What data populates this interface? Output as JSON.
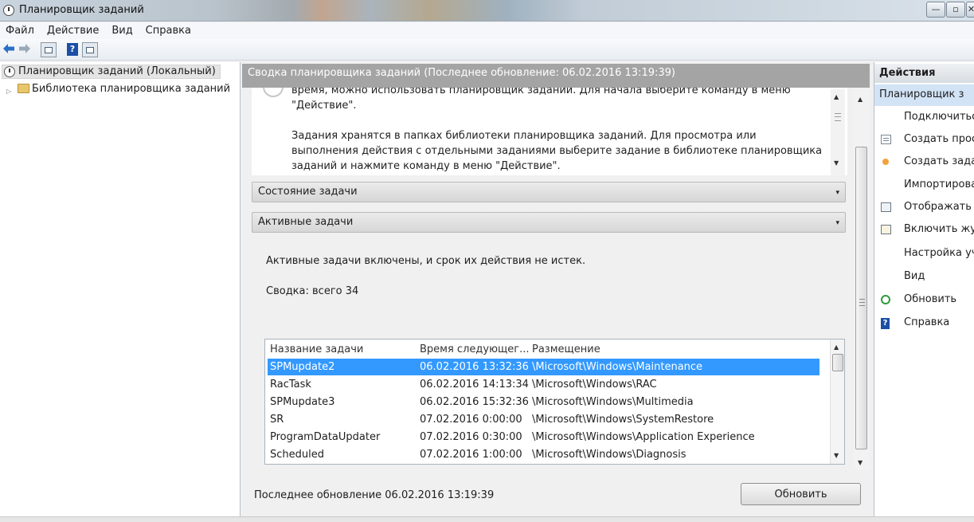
{
  "window": {
    "title": "Планировщик заданий",
    "minimize_glyph": "—",
    "maximize_glyph": "▫",
    "close_glyph": "✕"
  },
  "menu": {
    "items": [
      {
        "label": "Файл"
      },
      {
        "label": "Действие"
      },
      {
        "label": "Вид"
      },
      {
        "label": "Справка"
      }
    ]
  },
  "toolbar": {
    "help_glyph": "?"
  },
  "tree": {
    "root_label": "Планировщик заданий (Локальный)",
    "child_label": "Библиотека планировщика заданий",
    "expander_glyph": "▷"
  },
  "center": {
    "header": "Сводка планировщика заданий (Последнее обновление: 06.02.2016 13:19:39)",
    "overview_lines": [
      "время, можно использовать планировщик заданий. Для начала выберите команду в меню \"Действие\".",
      "Задания хранятся в папках библиотеки планировщика заданий. Для просмотра или выполнения действия с отдельными заданиями выберите задание в библиотеке планировщика заданий и нажмите команду в меню \"Действие\"."
    ],
    "task_status_label": "Состояние задачи",
    "active_tasks_label": "Активные задачи",
    "active_description": "Активные задачи включены, и срок их действия не истек.",
    "summary": "Сводка: всего 34",
    "last_update": "Последнее обновление 06.02.2016 13:19:39",
    "refresh_label": "Обновить",
    "caret_glyph": "▾"
  },
  "task_table": {
    "columns": [
      "Название задачи",
      "Время следующег...",
      "Размещение"
    ],
    "rows": [
      {
        "name": "SPMupdate2",
        "time": "06.02.2016 13:32:36",
        "location": "\\Microsoft\\Windows\\Maintenance",
        "selected": true
      },
      {
        "name": "RacTask",
        "time": "06.02.2016 14:13:34",
        "location": "\\Microsoft\\Windows\\RAC",
        "selected": false
      },
      {
        "name": "SPMupdate3",
        "time": "06.02.2016 15:32:36",
        "location": "\\Microsoft\\Windows\\Multimedia",
        "selected": false
      },
      {
        "name": "SR",
        "time": "07.02.2016 0:00:00",
        "location": "\\Microsoft\\Windows\\SystemRestore",
        "selected": false
      },
      {
        "name": "ProgramDataUpdater",
        "time": "07.02.2016 0:30:00",
        "location": "\\Microsoft\\Windows\\Application Experience",
        "selected": false
      },
      {
        "name": "Scheduled",
        "time": "07.02.2016 1:00:00",
        "location": "\\Microsoft\\Windows\\Diagnosis",
        "selected": false
      }
    ],
    "selected_color": "#3399ff"
  },
  "actions": {
    "header": "Действия",
    "group_label": "Планировщик з",
    "items": [
      {
        "label": "Подключиться",
        "icon": "none"
      },
      {
        "label": "Создать прост",
        "icon": "document-icon"
      },
      {
        "label": "Создать задач",
        "icon": "new-task-icon"
      },
      {
        "label": "Импортирова",
        "icon": "none"
      },
      {
        "label": "Отображать в",
        "icon": "view-icon"
      },
      {
        "label": "Включить жур",
        "icon": "log-icon"
      },
      {
        "label": "Настройка уч",
        "icon": "none"
      },
      {
        "label": "Вид",
        "icon": "none"
      },
      {
        "label": "Обновить",
        "icon": "refresh-icon"
      },
      {
        "label": "Справка",
        "icon": "help-icon"
      }
    ]
  }
}
